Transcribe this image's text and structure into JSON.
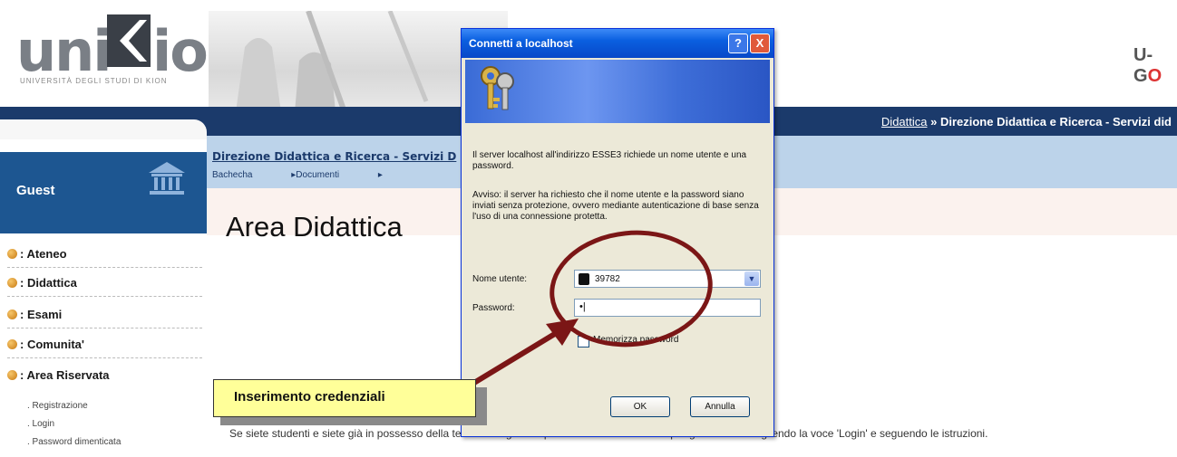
{
  "header": {
    "logo_part1": "uni",
    "logo_part2": "ion",
    "logo_subtitle": "UNIVERSITÀ DEGLI STUDI DI KION",
    "brand_right_a": "U-G",
    "brand_right_b": "O"
  },
  "breadcrumb": {
    "link": "Didattica",
    "separator": " » ",
    "current": "Direzione Didattica e Ricerca - Servizi did"
  },
  "subheader": {
    "title": "Direzione Didattica e Ricerca - Servizi D",
    "nav": [
      "Bachecha",
      "Documenti"
    ]
  },
  "sidebar": {
    "guest_label": "Guest",
    "items": [
      {
        "label": ": Ateneo"
      },
      {
        "label": ": Didattica"
      },
      {
        "label": ": Esami"
      },
      {
        "label": ": Comunita'"
      },
      {
        "label": ": Area Riservata"
      }
    ],
    "sub_items": [
      {
        "label": ". Registrazione"
      },
      {
        "label": ". Login"
      },
      {
        "label": ". Password dimenticata"
      }
    ]
  },
  "main": {
    "title": "Area Didattica",
    "bottom_text": "Se siete studenti e siete già in possesso della tessera magnetica potete accedere ai servizi per gli studenti scegliendo la voce 'Login' e seguendo le istruzioni."
  },
  "dialog": {
    "title": "Connetti a localhost",
    "help": "?",
    "close": "X",
    "message1": "Il server localhost all'indirizzo ESSE3 richiede un nome utente e una password.",
    "message2": "Avviso: il server ha richiesto che il nome utente e la password siano inviati senza protezione, ovvero mediante autenticazione di base senza l'uso di una connessione protetta.",
    "username_label": "Nome utente:",
    "username_value": "39782",
    "password_label": "Password:",
    "password_value": "•|",
    "remember_label": "Memorizza password",
    "ok_label": "OK",
    "cancel_label": "Annulla"
  },
  "annotation": {
    "callout_text": "Inserimento credenziali",
    "color": "#7b1616"
  }
}
